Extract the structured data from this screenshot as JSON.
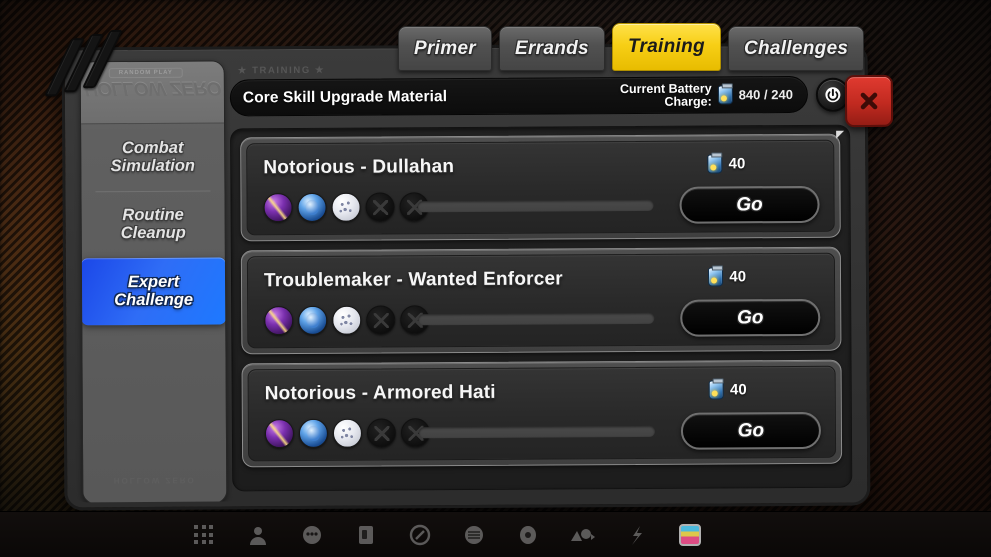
{
  "tabs": [
    {
      "label": "Primer",
      "active": false
    },
    {
      "label": "Errands",
      "active": false
    },
    {
      "label": "Training",
      "active": true
    },
    {
      "label": "Challenges",
      "active": false
    }
  ],
  "sidebar": {
    "chip": "RANDOM PLAY",
    "logo": "HOLLOW ZERO",
    "footer": "HOLLOW ZERO",
    "items": [
      {
        "label": "Combat Simulation",
        "active": false
      },
      {
        "label": "Routine Cleanup",
        "active": false
      },
      {
        "label": "Expert Challenge",
        "active": true
      }
    ]
  },
  "breadcrumb": "★ TRAINING ★",
  "header": {
    "title": "Core Skill Upgrade Material",
    "charge_label": "Current Battery\nCharge:",
    "charge_value": "840 / 240",
    "battery_icon": "battery-icon",
    "power_icon": "power-icon"
  },
  "close_button": {
    "label": "✕",
    "icon": "close-icon"
  },
  "cards": [
    {
      "title": "Notorious - Dullahan",
      "cost": "40",
      "go_label": "Go",
      "rewards": [
        "purple",
        "blue",
        "white",
        "empty",
        "empty"
      ]
    },
    {
      "title": "Troublemaker - Wanted Enforcer",
      "cost": "40",
      "go_label": "Go",
      "rewards": [
        "purple",
        "blue",
        "white",
        "empty",
        "empty"
      ]
    },
    {
      "title": "Notorious - Armored Hati",
      "cost": "40",
      "go_label": "Go",
      "rewards": [
        "purple",
        "blue",
        "white",
        "empty",
        "empty"
      ]
    }
  ],
  "taskbar": {
    "icons": [
      "grid-menu-icon",
      "character-icon",
      "agents-icon",
      "inventory-icon",
      "quest-icon",
      "shop-icon",
      "mail-icon",
      "events-icon",
      "settings-icon",
      "gallery-icon"
    ]
  },
  "colors": {
    "accent_tab": "#f7cf16",
    "accent_sidebar": "#2f6df6",
    "close": "#c12a20"
  }
}
